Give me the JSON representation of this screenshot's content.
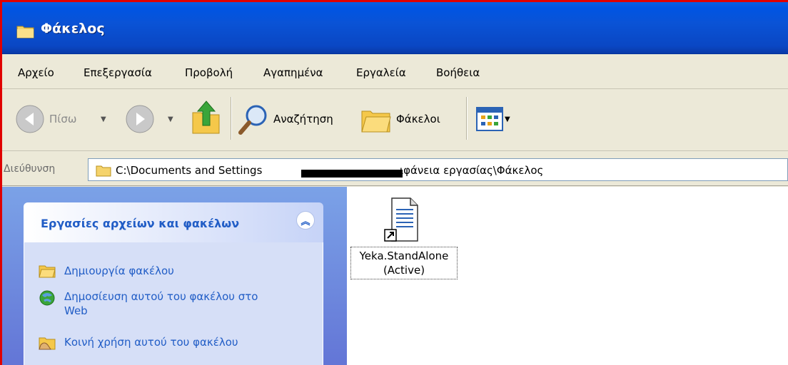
{
  "window": {
    "title": "Φάκελος"
  },
  "menu": {
    "items": [
      "Αρχείο",
      "Επεξεργασία",
      "Προβολή",
      "Αγαπημένα",
      "Εργαλεία",
      "Βοήθεια"
    ]
  },
  "toolbar": {
    "back_label": "Πίσω",
    "search_label": "Αναζήτηση",
    "folders_label": "Φάκελοι"
  },
  "address": {
    "label": "Διεύθυνση",
    "path_start": "C:\\Documents and Settings",
    "path_end": "ιφάνεια εργασίας\\Φάκελος"
  },
  "tasks": {
    "header": "Εργασίες αρχείων και φακέλων",
    "items": [
      "Δημιουργία φακέλου",
      "Δημοσίευση αυτού του φακέλου στο Web",
      "Κοινή χρήση αυτού του φακέλου"
    ]
  },
  "files": [
    {
      "name": "Yeka.StandAlone (Active)"
    }
  ],
  "colors": {
    "titlebar": "#0054e3",
    "frame_border": "#e00000",
    "task_link": "#215dc6"
  }
}
